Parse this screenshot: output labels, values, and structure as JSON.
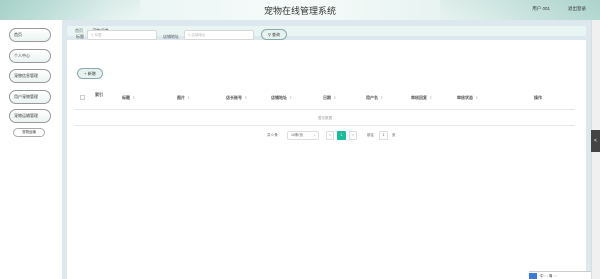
{
  "header": {
    "title": "宠物在线管理系统",
    "user": "用户 001",
    "logout": "退出登录"
  },
  "sidebar": {
    "items": [
      {
        "label": "首页"
      },
      {
        "label": "个人中心"
      },
      {
        "label": "宠物信息管理"
      },
      {
        "label": "用户宠物管理"
      },
      {
        "label": "宠物运输管理"
      }
    ],
    "sub_item": "宠物运输"
  },
  "breadcrumb": {
    "home": "首页",
    "separator": "/",
    "current": "宠物运输"
  },
  "search": {
    "field1_label": "标题",
    "field1_placeholder": "标题",
    "field2_label": "店铺地址",
    "field2_placeholder": "店铺地址",
    "query_label": "查询",
    "search_icon": "search-icon"
  },
  "actions": {
    "add_label": "+ 新增"
  },
  "table": {
    "columns": [
      "索引",
      "标题",
      "图片",
      "店长账号",
      "店铺地址",
      "日期",
      "用户名",
      "审核回复",
      "审核状态",
      "操作"
    ],
    "sort_glyph": "⇕",
    "empty_text": "暂无数据"
  },
  "pager": {
    "total": "共 0 条",
    "page_size": "10条/页",
    "prev": "<",
    "current_page": "1",
    "next": ">",
    "goto_label": "前往",
    "goto_value": "1",
    "page_suffix": "页"
  },
  "side_handle": "<",
  "taskbar": {
    "text": "中 ◦ ◦ 简 ◦ ◦"
  }
}
